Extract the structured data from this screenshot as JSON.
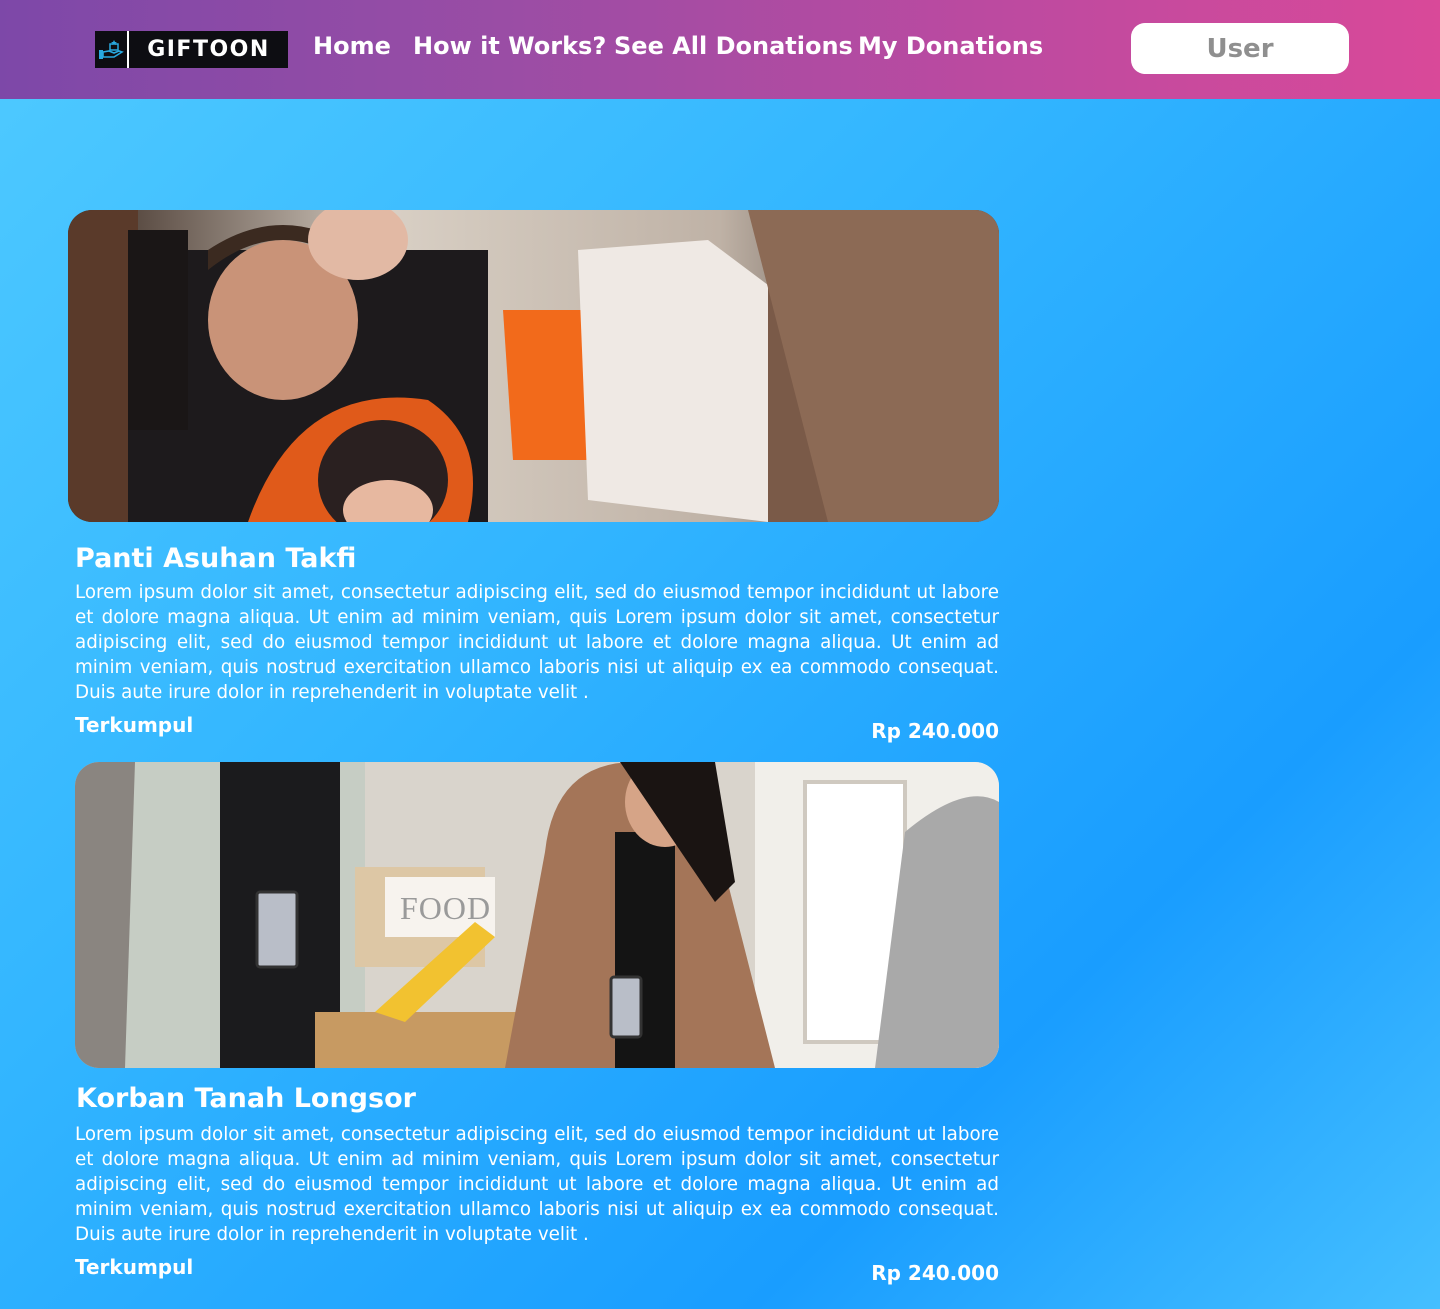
{
  "header": {
    "logo_text": "GIFTOON",
    "nav": [
      {
        "label": "Home"
      },
      {
        "label": "How it Works?"
      },
      {
        "label": "See All Donations"
      },
      {
        "label": "My Donations"
      }
    ],
    "user_label": "User"
  },
  "donations": [
    {
      "title": "Panti Asuhan Takfi",
      "description": "Lorem ipsum dolor sit amet, consectetur adipiscing elit, sed do eiusmod tempor incididunt ut labore et dolore magna aliqua. Ut enim ad minim veniam, quis Lorem ipsum dolor sit amet, consectetur adipiscing elit, sed do eiusmod tempor incididunt ut labore et dolore magna aliqua. Ut enim ad minim veniam, quis nostrud exercitation ullamco laboris nisi ut aliquip ex ea commodo consequat. Duis aute irure dolor in reprehenderit in voluptate velit .",
      "collected_label": "Terkumpul",
      "amount": "Rp 240.000"
    },
    {
      "title": "Korban Tanah Longsor",
      "description": "Lorem ipsum dolor sit amet, consectetur adipiscing elit, sed do eiusmod tempor incididunt ut labore et dolore magna aliqua. Ut enim ad minim veniam, quis Lorem ipsum dolor sit amet, consectetur adipiscing elit, sed do eiusmod tempor incididunt ut labore et dolore magna aliqua. Ut enim ad minim veniam, quis nostrud exercitation ullamco laboris nisi ut aliquip ex ea commodo consequat. Duis aute irure dolor in reprehenderit in voluptate velit .",
      "collected_label": "Terkumpul",
      "amount": "Rp 240.000",
      "image_sign_text": "FOOD"
    }
  ],
  "colors": {
    "header_gradient_start": "#7d48a8",
    "header_gradient_end": "#d94999",
    "background_light": "#4fcaff",
    "background_deep": "#199dff",
    "user_text": "#8f8f8f"
  },
  "icons": [
    "donation-hand-icon"
  ]
}
